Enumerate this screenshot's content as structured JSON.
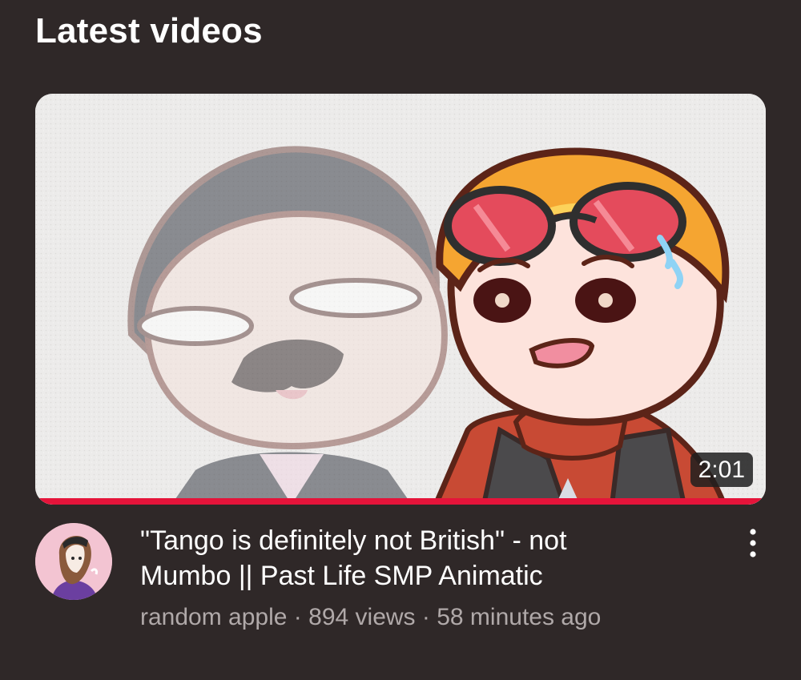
{
  "section": {
    "title": "Latest videos"
  },
  "video": {
    "title": "\"Tango is definitely not British\" - not Mumbo || Past Life SMP Animatic",
    "duration": "2:01",
    "watch_progress": 1.0,
    "channel": "random apple",
    "views": "894 views",
    "age": "58 minutes ago",
    "separator": " · ",
    "more_icon": "more-vertical-icon"
  },
  "colors": {
    "background": "#2f2828",
    "progress": "#e5143a",
    "meta_text": "#b0a9a9"
  }
}
